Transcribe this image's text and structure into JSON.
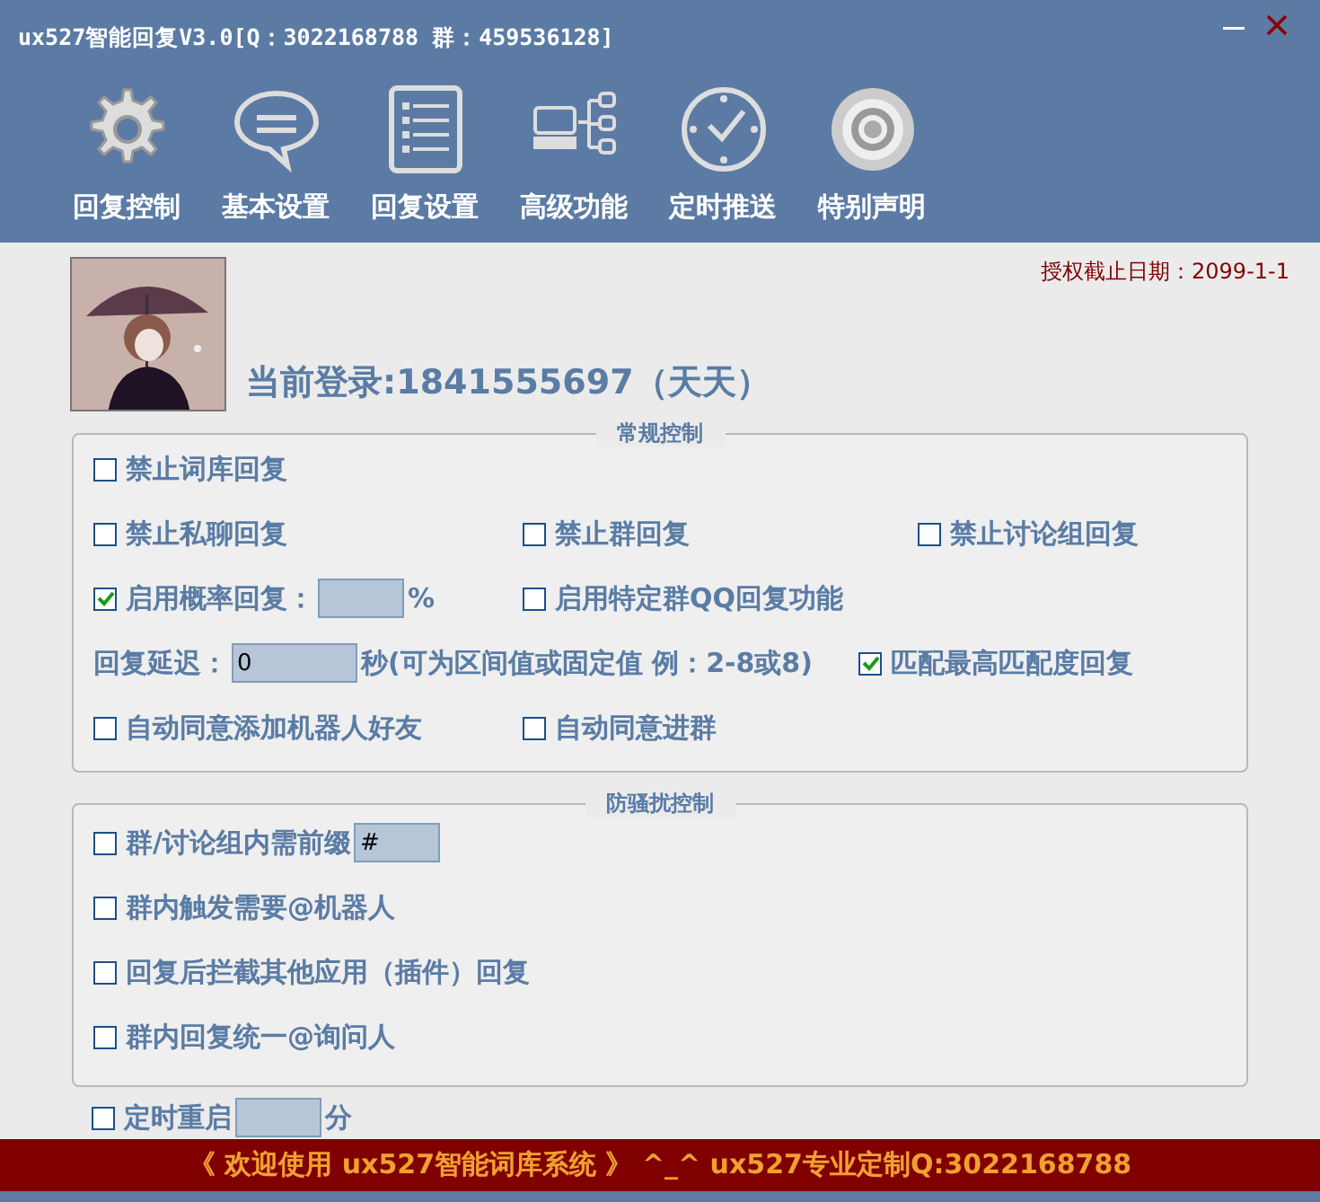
{
  "window": {
    "title": "ux527智能回复V3.0[Q：3022168788 群：459536128]"
  },
  "toolbar": [
    {
      "label": "回复控制"
    },
    {
      "label": "基本设置"
    },
    {
      "label": "回复设置"
    },
    {
      "label": "高级功能"
    },
    {
      "label": "定时推送"
    },
    {
      "label": "特别声明"
    }
  ],
  "license": "授权截止日期：2099-1-1",
  "login": "当前登录:1841555697（天天）",
  "groups": [
    {
      "title": "常规控制",
      "rows": [
        [
          {
            "kind": "checkbox",
            "label": "禁止词库回复",
            "checked": false
          }
        ],
        [
          {
            "kind": "checkbox",
            "label": "禁止私聊回复",
            "checked": false
          },
          {
            "kind": "checkbox",
            "label": "禁止群回复",
            "checked": false
          },
          {
            "kind": "checkbox",
            "label": "禁止讨论组回复",
            "checked": false
          }
        ],
        [
          {
            "kind": "checkbox",
            "label": "启用概率回复：",
            "checked": true,
            "has_field": true,
            "suffix": "%"
          },
          {
            "kind": "checkbox",
            "label": "启用特定群QQ回复功能",
            "checked": false
          }
        ],
        [
          {
            "kind": "field",
            "colspan": 2,
            "label": "回复延迟：",
            "has_field": true,
            "input": "0",
            "suffix": "秒(可为区间值或固定值 例：2-8或8)"
          },
          {
            "kind": "checkbox",
            "label": "匹配最高匹配度回复",
            "checked": true
          }
        ],
        [
          {
            "kind": "checkbox",
            "label": "自动同意添加机器人好友",
            "checked": false
          },
          {
            "kind": "checkbox",
            "label": "自动同意进群",
            "checked": false
          }
        ]
      ]
    },
    {
      "title": "防骚扰控制",
      "rows": [
        [
          {
            "kind": "checkbox",
            "label": "群/讨论组内需前缀",
            "checked": false,
            "has_field": true,
            "input": "#"
          }
        ],
        [
          {
            "kind": "checkbox",
            "label": "群内触发需要@机器人",
            "checked": false
          }
        ],
        [
          {
            "kind": "checkbox",
            "label": "回复后拦截其他应用（插件）回复",
            "checked": false
          }
        ],
        [
          {
            "kind": "checkbox",
            "label": "群内回复统一@询问人",
            "checked": false
          }
        ]
      ]
    }
  ],
  "extra_row": [
    {
      "kind": "checkbox",
      "label": "定时重启",
      "checked": false,
      "has_field": true,
      "suffix": "分"
    }
  ],
  "footer": "《 欢迎使用 ux527智能词库系统 》 ^_^ ux527专业定制Q:3022168788"
}
